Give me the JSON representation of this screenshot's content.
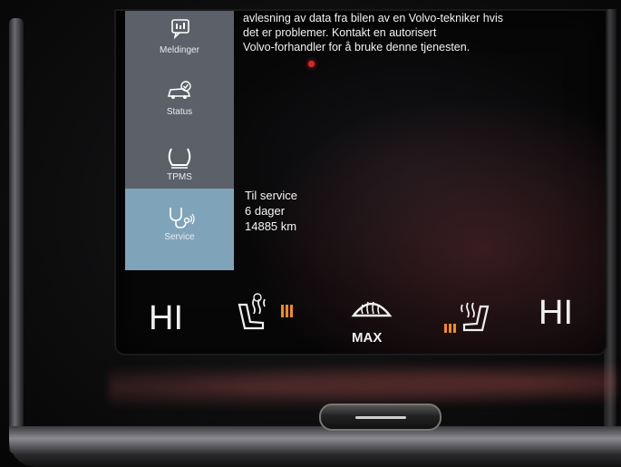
{
  "sidebar": {
    "items": [
      {
        "label": "Meldinger",
        "icon": "message-icon"
      },
      {
        "label": "Status",
        "icon": "car-check-icon"
      },
      {
        "label": "TPMS",
        "icon": "tire-pressure-icon"
      },
      {
        "label": "Service",
        "icon": "stethoscope-icon",
        "active": true
      }
    ]
  },
  "message": {
    "lines": [
      "avlesning av data fra bilen av en Volvo-tekniker hvis",
      "det er problemer. Kontakt en autorisert",
      "Volvo-forhandler for å bruke denne tjenesten."
    ]
  },
  "service": {
    "line1": "Til service",
    "line2": "6 dager",
    "line3": "14885 km"
  },
  "climate": {
    "left_temp": "HI",
    "right_temp": "HI",
    "defrost_label": "MAX",
    "heat_color": "#f58a1f"
  }
}
